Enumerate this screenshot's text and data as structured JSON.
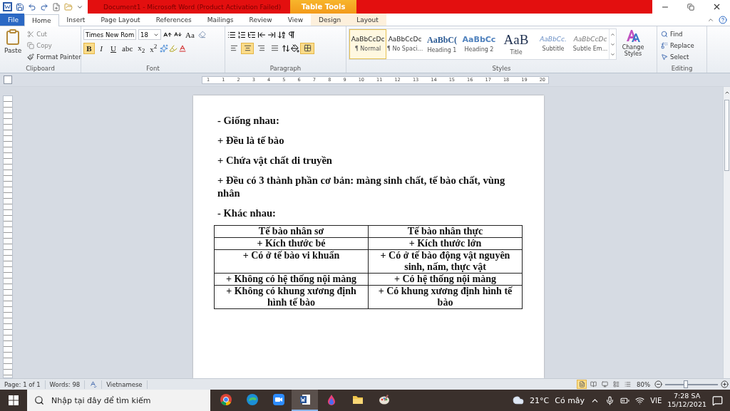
{
  "title_bar": {
    "title": "Document1  -  Microsoft Word (Product Activation Failed)",
    "context_label": "Table Tools"
  },
  "tabs": [
    {
      "label": "File",
      "kind": "file",
      "selected": false
    },
    {
      "label": "Home",
      "kind": "main",
      "selected": true
    },
    {
      "label": "Insert",
      "kind": "main",
      "selected": false
    },
    {
      "label": "Page Layout",
      "kind": "main",
      "selected": false
    },
    {
      "label": "References",
      "kind": "main",
      "selected": false
    },
    {
      "label": "Mailings",
      "kind": "main",
      "selected": false
    },
    {
      "label": "Review",
      "kind": "main",
      "selected": false
    },
    {
      "label": "View",
      "kind": "main",
      "selected": false
    },
    {
      "label": "Design",
      "kind": "context",
      "selected": false
    },
    {
      "label": "Layout",
      "kind": "context",
      "selected": false
    }
  ],
  "clipboard": {
    "label": "Clipboard",
    "paste": "Paste",
    "items": [
      "Cut",
      "Copy",
      "Format Painter"
    ]
  },
  "font": {
    "label": "Font",
    "font_name": "Times New Rom",
    "font_size": "18",
    "change_case": "Aa",
    "format_buttons": [
      {
        "label": "B",
        "selected": true
      },
      {
        "label": "I",
        "selected": false
      },
      {
        "label": "U",
        "selected": false
      },
      {
        "label": "abc",
        "selected": false
      },
      {
        "label": "x$_{2}$",
        "selected": false
      },
      {
        "label": "x$^{2}$",
        "selected": false
      }
    ]
  },
  "paragraph": {
    "label": "Paragraph",
    "alignments": [
      {
        "kind": "left",
        "selected": false
      },
      {
        "kind": "center",
        "selected": true
      },
      {
        "kind": "right",
        "selected": false
      },
      {
        "kind": "justify",
        "selected": false
      }
    ],
    "borders_selected": true
  },
  "styles": {
    "label": "Styles",
    "items": [
      {
        "preview": "AaBbCcDc",
        "name": "¶ Normal",
        "kind": "plain",
        "selected": true
      },
      {
        "preview": "AaBbCcDc",
        "name": "¶ No Spaci...",
        "kind": "plain",
        "selected": false
      },
      {
        "preview": "AaBbC(",
        "name": "Heading 1",
        "kind": "heading1",
        "selected": false
      },
      {
        "preview": "AaBbCc",
        "name": "Heading 2",
        "kind": "heading2",
        "selected": false
      },
      {
        "preview": "AaB",
        "name": "Title",
        "kind": "title",
        "selected": false
      },
      {
        "preview": "AaBbCc.",
        "name": "Subtitle",
        "kind": "subtitle",
        "selected": false
      },
      {
        "preview": "AaBbCcDc",
        "name": "Subtle Em...",
        "kind": "subtle",
        "selected": false
      }
    ],
    "change_styles": "Change Styles"
  },
  "editing": {
    "label": "Editing",
    "items": [
      {
        "label": "Find",
        "kind": "find"
      },
      {
        "label": "Replace",
        "kind": "replace"
      },
      {
        "label": "Select",
        "kind": "select"
      }
    ]
  },
  "ruler": [
    "1",
    "1",
    "2",
    "3",
    "4",
    "5",
    "6",
    "7",
    "8",
    "9",
    "10",
    "11",
    "12",
    "13",
    "14",
    "15",
    "16",
    "17",
    "18",
    "19",
    "20"
  ],
  "document": {
    "paragraphs": [
      "- Giống nhau:",
      "+ Đều là tế bào",
      "+ Chứa vật chất di truyền",
      "+ Đều có 3 thành phần cơ bản: màng sinh chất, tế bào chất, vùng nhân",
      "- Khác nhau:"
    ],
    "table": {
      "header": [
        "Tế bào nhân sơ",
        "Tế bào nhân thực"
      ],
      "rows": [
        [
          "+ Kích thước bé",
          "+ Kích thước lớn"
        ],
        [
          "+ Có ở tế bào vi khuẩn",
          "+ Có ở tế bào động vật nguyên sinh, nấm, thực vật"
        ],
        [
          "+ Không có hệ thống nội màng",
          "+ Có hệ thống nội màng"
        ],
        [
          "+ Không có khung xương định hình tế bào",
          "+ Có khung xương định hình tế bào"
        ]
      ]
    }
  },
  "status_bar": {
    "page": "Page: 1 of 1",
    "words": "Words: 98",
    "language": "Vietnamese",
    "views": [
      {
        "kind": "print",
        "selected": true
      },
      {
        "kind": "read",
        "selected": false
      },
      {
        "kind": "web",
        "selected": false
      },
      {
        "kind": "outline",
        "selected": false
      },
      {
        "kind": "draft",
        "selected": false
      }
    ],
    "zoom": "80%",
    "zoom_slider": {
      "level": 0.39
    }
  },
  "taskbar": {
    "search_placeholder": "Nhập tại đây để tìm kiếm",
    "apps": [
      {
        "kind": "chrome",
        "selected": false
      },
      {
        "kind": "edge",
        "selected": false
      },
      {
        "kind": "zoom",
        "selected": false
      },
      {
        "kind": "word",
        "selected": true
      },
      {
        "kind": "drop",
        "selected": false
      },
      {
        "kind": "folder",
        "selected": false
      },
      {
        "kind": "palette",
        "selected": false
      }
    ],
    "temperature": "21°C",
    "weather": "Có mây",
    "input_language": "VIE",
    "time": "7:28 SA",
    "date": "15/12/2021"
  }
}
